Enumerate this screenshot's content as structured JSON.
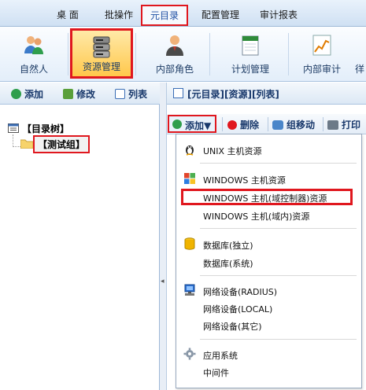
{
  "menu": {
    "items": [
      {
        "label": "桌 面"
      },
      {
        "label": "批操作"
      },
      {
        "label": "元目录"
      },
      {
        "label": "配置管理"
      },
      {
        "label": "审计报表"
      }
    ]
  },
  "modules": [
    {
      "label": "自然人",
      "icon": "users-icon"
    },
    {
      "label": "资源管理",
      "icon": "server-icon"
    },
    {
      "label": "内部角色",
      "icon": "person-icon"
    },
    {
      "label": "计划管理",
      "icon": "calendar-icon"
    },
    {
      "label": "内部审计",
      "icon": "chart-icon"
    },
    {
      "label": "徉"
    }
  ],
  "left_toolbar": {
    "add": "添加",
    "edit": "修改",
    "list": "列表"
  },
  "tree": {
    "root": "【目录树】",
    "child": "【测试组】"
  },
  "right": {
    "title": "[元目录][资源][列表]",
    "toolbar": {
      "add": "添加▼",
      "delete": "删除",
      "move": "组移动",
      "print": "打印"
    }
  },
  "dropdown": {
    "unix": "UNIX 主机资源",
    "windows": "WINDOWS 主机资源",
    "windows_dc": "WINDOWS 主机(域控制器)资源",
    "windows_domain": "WINDOWS 主机(域内)资源",
    "db_standalone": "数据库(独立)",
    "db_system": "数据库(系统)",
    "net_radius": "网络设备(RADIUS)",
    "net_local": "网络设备(LOCAL)",
    "net_other": "网络设备(其它)",
    "app_system": "应用系统",
    "middleware": "中间件"
  },
  "colors": {
    "highlight": "#e0171e",
    "accent": "#1d4fa3"
  }
}
